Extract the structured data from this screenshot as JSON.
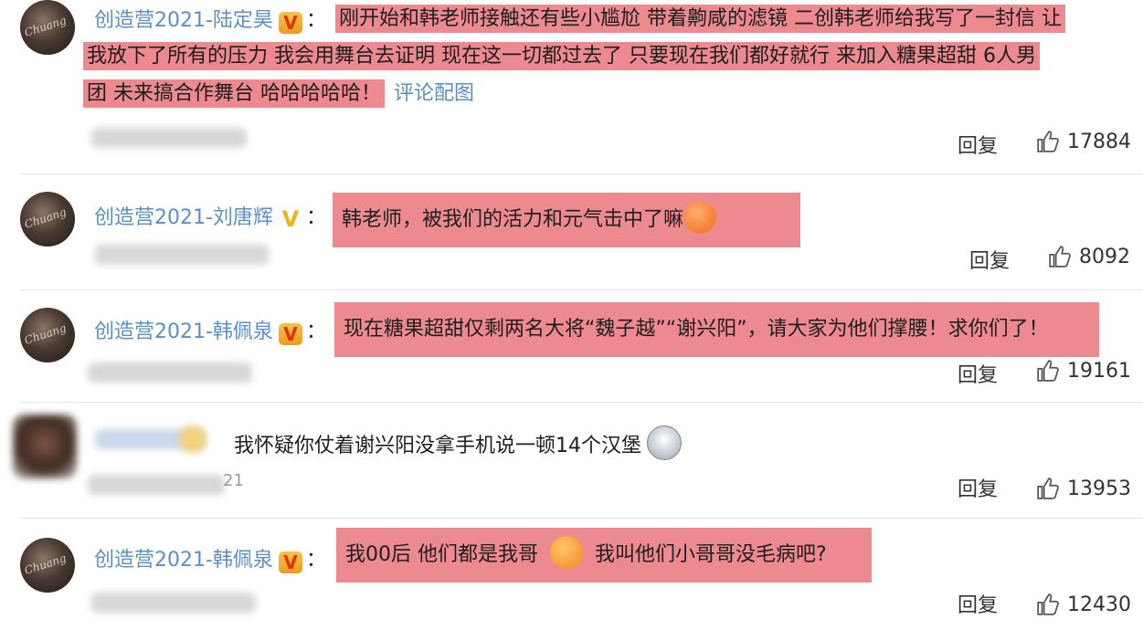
{
  "comments": [
    {
      "name": "创造营2021-陆定昊",
      "text_lines": [
        "刚开始和韩老师接触还有些小尴尬 带着齁咸的滤镜 二创韩老师给我写了一封信 让",
        "我放下了所有的压力 我会用舞台去证明 现在这一切都过去了 只要现在我们都好就行 来加入糖果超甜 6人男",
        "团 未来搞合作舞台 哈哈哈哈哈！"
      ],
      "link": "评论配图",
      "reply": "回复",
      "likes": "17884"
    },
    {
      "name": "创造营2021-刘唐辉",
      "text": "韩老师，被我们的活力和元气击中了嘛",
      "emoji": "fearful-face-icon",
      "reply": "回复",
      "likes": "8092"
    },
    {
      "name": "创造营2021-韩佩泉",
      "text": "现在糖果超甜仅剩两名大将“魏子越”“谢兴阳”，请大家为他们撑腰！求你们了！",
      "reply": "回复",
      "likes": "19161"
    },
    {
      "text": "我怀疑你仗着谢兴阳没拿手机说一顿14个汉堡",
      "emoji": "husky-dog-icon",
      "partial_meta": "21",
      "reply": "回复",
      "likes": "13953"
    },
    {
      "name": "创造营2021-韩佩泉",
      "text_a": "我00后 他们都是我哥",
      "emoji": "smile-face-icon",
      "text_b": "我叫他们小哥哥没毛病吧?",
      "reply": "回复",
      "likes": "12430"
    }
  ],
  "colors": {
    "name_blue": "#5a8fc8",
    "highlight_pink": "#ec8a90",
    "badge_orange": "#f09a1f"
  }
}
